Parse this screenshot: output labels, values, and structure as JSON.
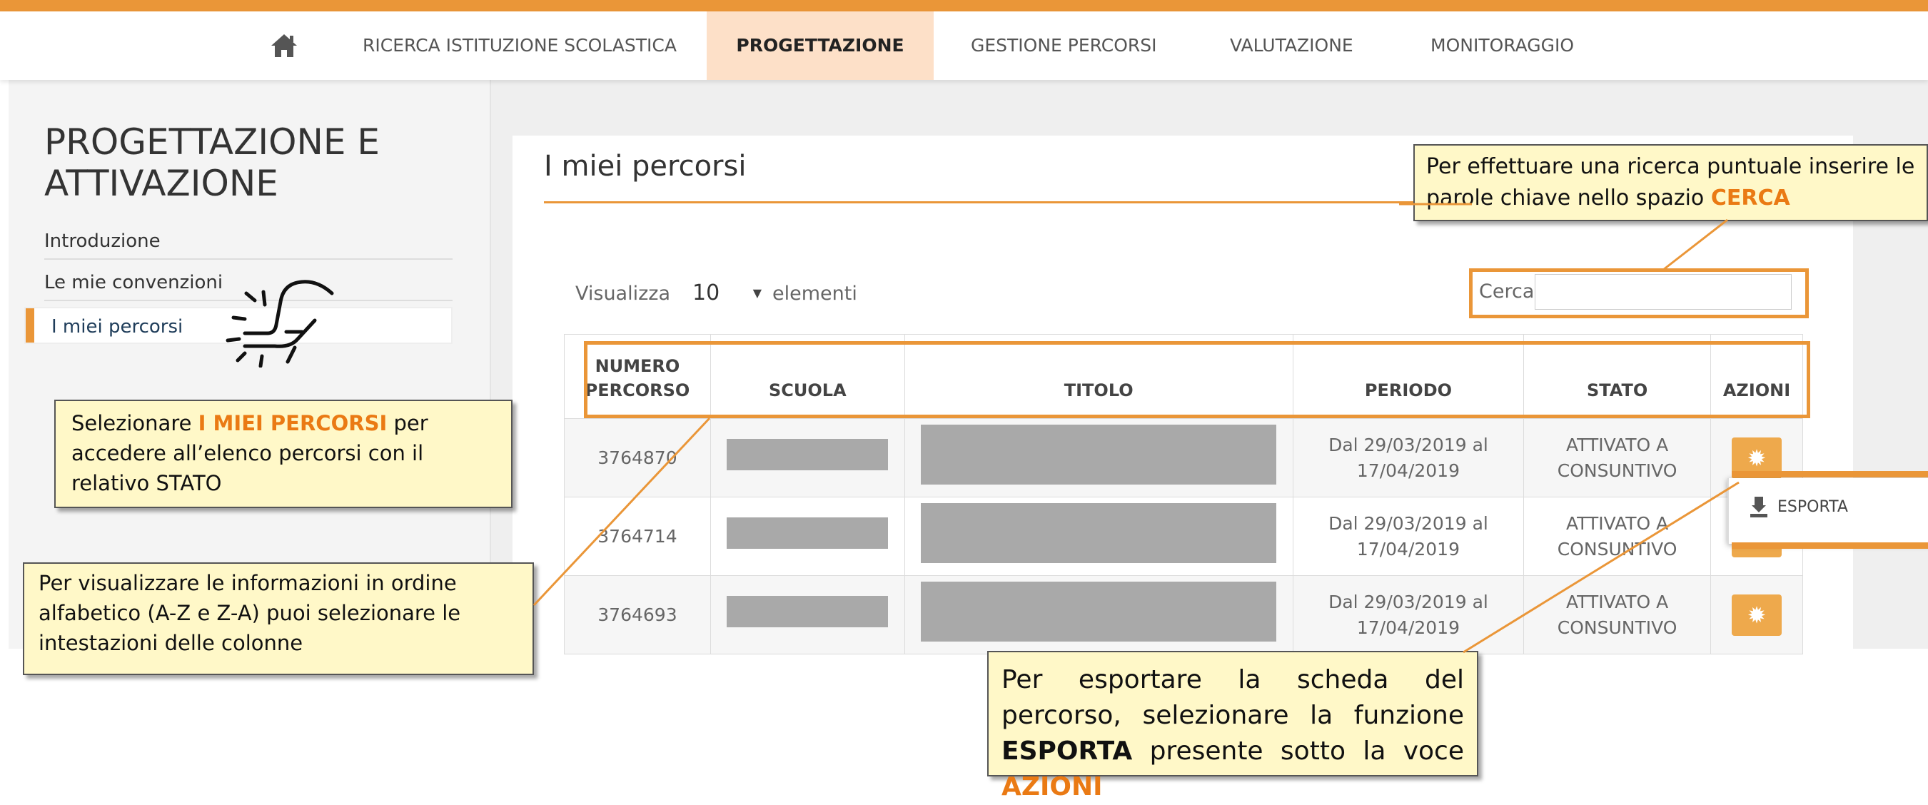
{
  "nav": {
    "items": [
      "RICERCA ISTITUZIONE SCOLASTICA",
      "PROGETTAZIONE",
      "GESTIONE PERCORSI",
      "VALUTAZIONE",
      "MONITORAGGIO"
    ],
    "active": "PROGETTAZIONE"
  },
  "sidebar": {
    "title": "PROGETTAZIONE E\nATTIVAZIONE",
    "items": [
      "Introduzione",
      "Le mie convenzioni",
      "I miei percorsi"
    ]
  },
  "main": {
    "title": "I miei percorsi",
    "show_label": "Visualizza",
    "show_value": "10",
    "show_suffix": "elementi",
    "search_label": "Cerca:",
    "search_value": ""
  },
  "table": {
    "headers": [
      "NUMERO PERCORSO",
      "SCUOLA",
      "TITOLO",
      "PERIODO",
      "STATO",
      "AZIONI"
    ],
    "rows": [
      {
        "numero": "3764870",
        "periodo": "Dal 29/03/2019 al 17/04/2019",
        "stato": "ATTIVATO A CONSUNTIVO"
      },
      {
        "numero": "3764714",
        "periodo": "Dal 29/03/2019 al 17/04/2019",
        "stato": "ATTIVATO A CONSUNTIVO"
      },
      {
        "numero": "3764693",
        "periodo": "Dal 29/03/2019 al 17/04/2019",
        "stato": "ATTIVATO A CONSUNTIVO"
      }
    ]
  },
  "dropdown": {
    "esporta": "ESPORTA"
  },
  "callouts": {
    "search": {
      "text": "Per effettuare una ricerca puntuale inserire le parole chiave nello spazio ",
      "highlight": "CERCA"
    },
    "sidebar": {
      "prefix": "Selezionare ",
      "highlight": "I MIEI PERCORSI",
      "suffix": " per accedere all’elenco percorsi con il relativo STATO"
    },
    "sort": {
      "text": "Per visualizzare le informazioni in ordine alfabetico (A-Z e Z-A) puoi selezionare le intestazioni delle colonne"
    },
    "export": {
      "prefix": "Per esportare la scheda del percorso, selezionare la funzione ",
      "strong": "ESPORTA",
      "middle": " presente sotto la voce ",
      "highlight": "AZIONI"
    }
  },
  "colors": {
    "accent": "#ea9638",
    "active_nav_bg": "#fde0c8",
    "callout_bg": "#fff8c8",
    "redaction": "#a9a9a9"
  },
  "icons": [
    "home-icon",
    "gear-icon",
    "export-icon",
    "hand-pointer-icon"
  ]
}
